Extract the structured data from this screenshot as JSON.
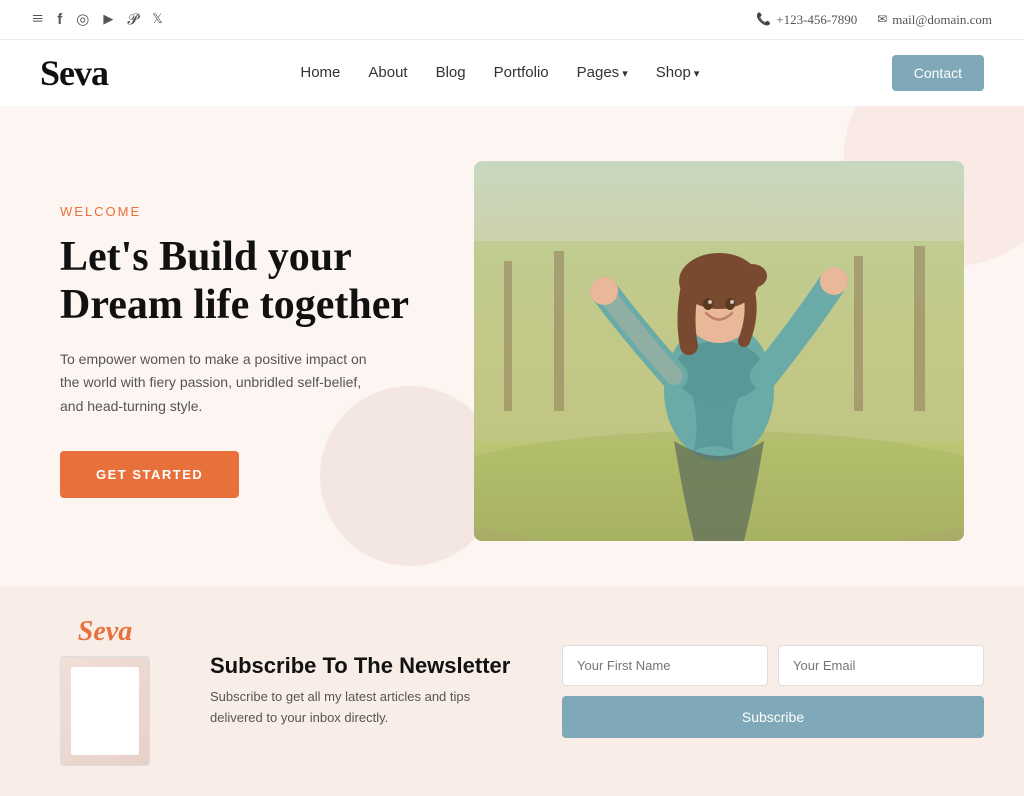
{
  "topbar": {
    "phone": "+123-456-7890",
    "email": "mail@domain.com"
  },
  "navbar": {
    "logo": "Seva",
    "links": [
      {
        "label": "Home",
        "id": "home",
        "dropdown": false
      },
      {
        "label": "About",
        "id": "about",
        "dropdown": false
      },
      {
        "label": "Blog",
        "id": "blog",
        "dropdown": false
      },
      {
        "label": "Portfolio",
        "id": "portfolio",
        "dropdown": false
      },
      {
        "label": "Pages",
        "id": "pages",
        "dropdown": true
      },
      {
        "label": "Shop",
        "id": "shop",
        "dropdown": true
      }
    ],
    "contact_label": "Contact"
  },
  "hero": {
    "welcome_label": "Welcome",
    "title_line1": "Let's Build your",
    "title_line2": "Dream life together",
    "description": "To empower women to make a positive impact on the world with fiery passion, unbridled self-belief, and head-turning style.",
    "cta_label": "GET STARTED"
  },
  "newsletter": {
    "logo": "Seva",
    "title": "Subscribe To The Newsletter",
    "description": "Subscribe to get all my latest articles and tips delivered to your inbox directly.",
    "first_name_placeholder": "Your First Name",
    "email_placeholder": "Your Email",
    "subscribe_label": "Subscribe"
  }
}
